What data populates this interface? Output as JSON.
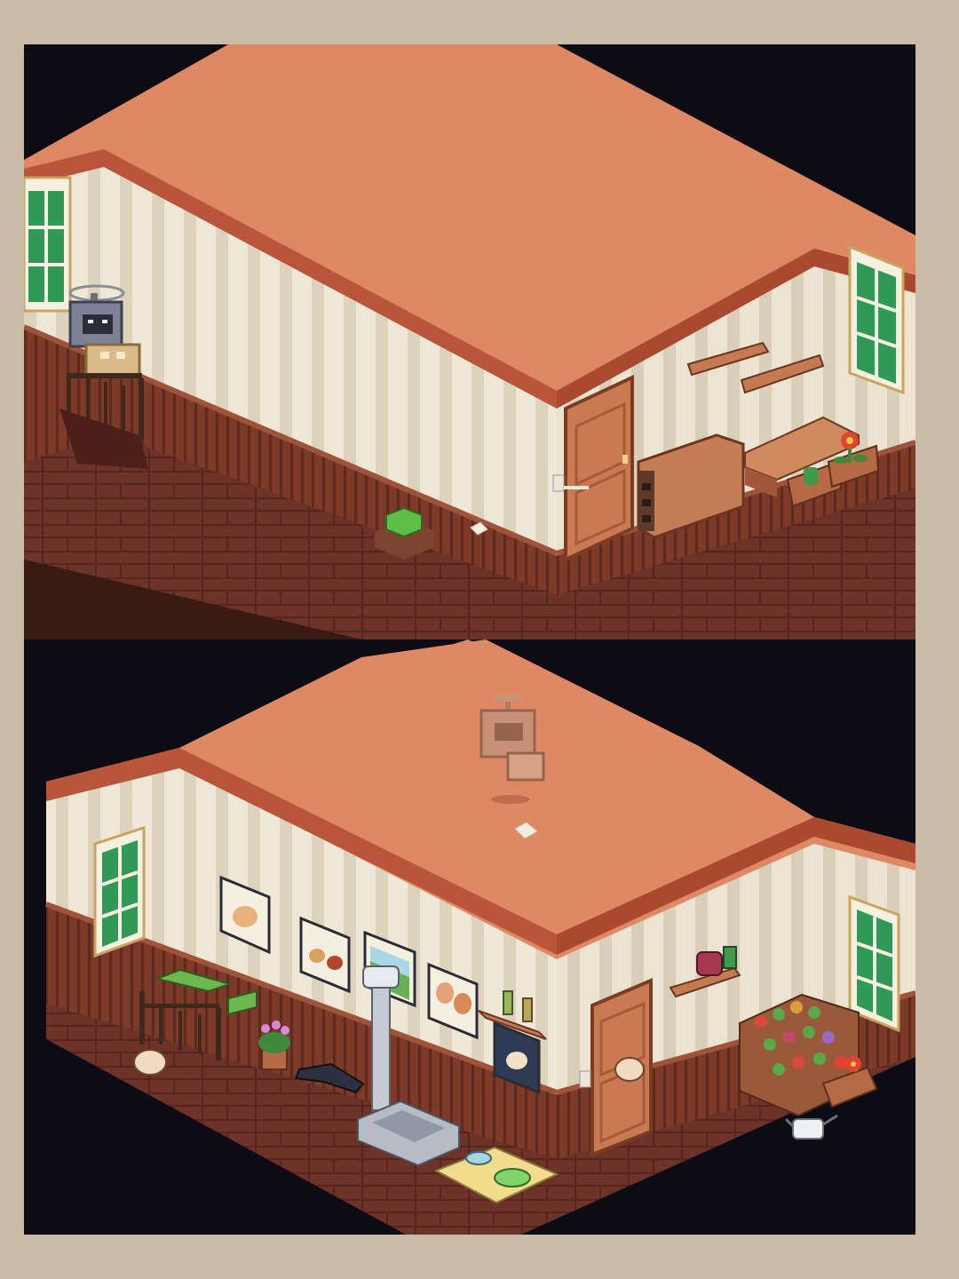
{
  "screenshot": {
    "panels": [
      {
        "id": "room-before",
        "label": "",
        "items": [
          "window-left",
          "window-right",
          "robot-helper-icon",
          "stair-railing",
          "stair-down",
          "door",
          "shelf-upper-left",
          "shelf-upper-right",
          "storage-cabinet",
          "wooden-bench",
          "potted-cactus-planter",
          "red-flower-planter",
          "green-slime-block-icon",
          "paper-note-icon",
          "light-switch"
        ]
      },
      {
        "id": "room-after",
        "label": "",
        "items": [
          "window-left",
          "window-right",
          "floating-robot-icon",
          "paper-note-icon",
          "picture-dog",
          "picture-pets",
          "picture-landscape",
          "picture-kids",
          "picture-hands",
          "shelf-bottles",
          "shelf-radio",
          "stair-railing",
          "green-cushion-bench",
          "pink-flower-pot",
          "skateboard-icon",
          "scale-tower",
          "sink-tub",
          "pet-bowls-mat",
          "vegetable-shelf",
          "watering-can-icon",
          "hand-cursor-icon",
          "door",
          "light-switch"
        ]
      }
    ]
  },
  "colors": {
    "page_bg": "#c9bca6",
    "void": "#0d0c14",
    "ceiling": "#de8864",
    "ceiling_edge": "#b8553a",
    "wall_stripe_light": "#efe8d7",
    "wall_stripe_dark": "#dcd2bc",
    "wainscot": "#7f3b2a",
    "floor": "#6e3328",
    "door": "#c97a52",
    "window_pane": "#2f9a58"
  }
}
